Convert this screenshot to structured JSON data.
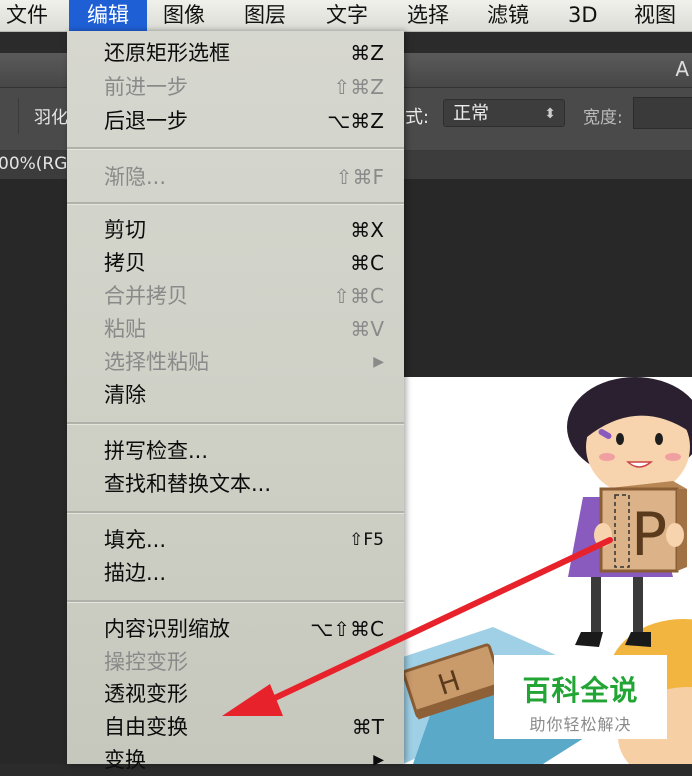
{
  "menubar": {
    "items": [
      "文件",
      "编辑",
      "图像",
      "图层",
      "文字",
      "选择",
      "滤镜",
      "3D",
      "视图"
    ]
  },
  "window": {
    "title_fragment": "A"
  },
  "options": {
    "feather_label": "羽化",
    "style_label": "式:",
    "style_value": "正常",
    "width_label": "宽度:"
  },
  "doc_tab": {
    "label": "00%(RG"
  },
  "edit_menu": {
    "items": [
      {
        "label": "还原矩形选框",
        "shortcut": "⌘Z",
        "enabled": true
      },
      {
        "label": "前进一步",
        "shortcut": "⇧⌘Z",
        "enabled": false
      },
      {
        "label": "后退一步",
        "shortcut": "⌥⌘Z",
        "enabled": true
      },
      {
        "label": "渐隐...",
        "shortcut": "⇧⌘F",
        "enabled": false
      },
      {
        "label": "剪切",
        "shortcut": "⌘X",
        "enabled": true
      },
      {
        "label": "拷贝",
        "shortcut": "⌘C",
        "enabled": true
      },
      {
        "label": "合并拷贝",
        "shortcut": "⇧⌘C",
        "enabled": false
      },
      {
        "label": "粘贴",
        "shortcut": "⌘V",
        "enabled": false
      },
      {
        "label": "选择性粘贴",
        "shortcut": "▶",
        "enabled": false
      },
      {
        "label": "清除",
        "shortcut": "",
        "enabled": true
      },
      {
        "label": "拼写检查...",
        "shortcut": "",
        "enabled": true
      },
      {
        "label": "查找和替换文本...",
        "shortcut": "",
        "enabled": true
      },
      {
        "label": "填充...",
        "shortcut": "⇧F5",
        "enabled": true
      },
      {
        "label": "描边...",
        "shortcut": "",
        "enabled": true
      },
      {
        "label": "内容识别缩放",
        "shortcut": "⌥⇧⌘C",
        "enabled": true
      },
      {
        "label": "操控变形",
        "shortcut": "",
        "enabled": false
      },
      {
        "label": "透视变形",
        "shortcut": "",
        "enabled": true
      },
      {
        "label": "自由变换",
        "shortcut": "⌘T",
        "enabled": true
      },
      {
        "label": "变换",
        "shortcut": "▶",
        "enabled": true
      }
    ]
  },
  "image": {
    "block_letter_p": "P",
    "block_letter_h": "H"
  },
  "watermark": {
    "title": "百科全说",
    "subtitle": "助你轻松解决"
  },
  "colors": {
    "menu_active": "#1f5fd6",
    "arrow": "#e8222b",
    "watermark_green": "#22a535"
  }
}
